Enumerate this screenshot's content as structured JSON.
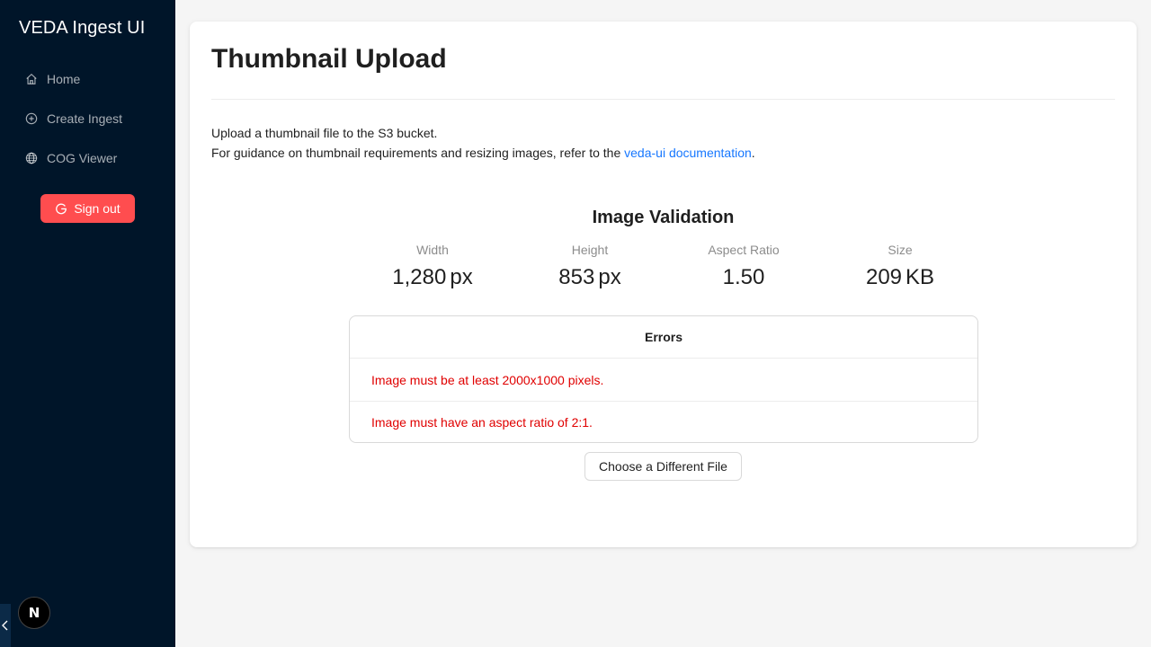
{
  "sidebar": {
    "app_title": "VEDA Ingest UI",
    "items": [
      {
        "label": "Home",
        "icon": "home-icon"
      },
      {
        "label": "Create Ingest",
        "icon": "plus-circle-icon"
      },
      {
        "label": "COG Viewer",
        "icon": "globe-icon"
      }
    ],
    "sign_out_label": "Sign out",
    "badge": "N"
  },
  "main": {
    "title": "Thumbnail Upload",
    "description_line1": "Upload a thumbnail file to the S3 bucket.",
    "description_line2_prefix": "For guidance on thumbnail requirements and resizing images, refer to the ",
    "description_link": "veda-ui documentation",
    "description_line2_suffix": ".",
    "validation": {
      "title": "Image Validation",
      "stats": [
        {
          "label": "Width",
          "value": "1,280",
          "unit": "px"
        },
        {
          "label": "Height",
          "value": "853",
          "unit": "px"
        },
        {
          "label": "Aspect Ratio",
          "value": "1.50",
          "unit": ""
        },
        {
          "label": "Size",
          "value": "209",
          "unit": "KB"
        }
      ]
    },
    "errors": {
      "title": "Errors",
      "items": [
        "Image must be at least 2000x1000 pixels.",
        "Image must have an aspect ratio of 2:1."
      ]
    },
    "choose_button_label": "Choose a Different File"
  },
  "colors": {
    "sidebar_bg": "#001529",
    "danger": "#ff4d4f",
    "link": "#1677ff",
    "error_text": "#e00000"
  }
}
